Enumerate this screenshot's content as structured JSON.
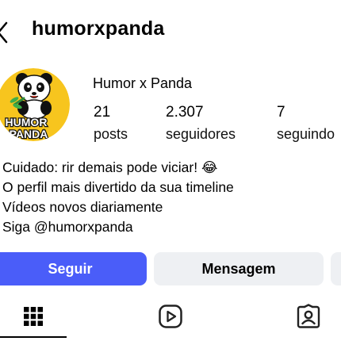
{
  "header": {
    "username": "humorxpanda"
  },
  "profile": {
    "display_name": "Humor x Panda",
    "avatar_text_top": "HUMOR",
    "avatar_text_bottom": "PANDA"
  },
  "stats": [
    {
      "value": "21",
      "label": "posts"
    },
    {
      "value": "2.307",
      "label": "seguidores"
    },
    {
      "value": "7",
      "label": "seguindo"
    }
  ],
  "bio": {
    "lines": [
      "Cuidado: rir demais pode viciar! 😂",
      "O perfil mais divertido da sua timeline",
      "Vídeos novos diariamente",
      "Siga @humorxpanda"
    ]
  },
  "actions": {
    "follow_label": "Seguir",
    "message_label": "Mensagem"
  },
  "tabs": [
    {
      "icon": "grid-icon",
      "active": true
    },
    {
      "icon": "reels-icon",
      "active": false
    },
    {
      "icon": "tagged-icon",
      "active": false
    }
  ],
  "colors": {
    "follow_button": "#4a5df9",
    "secondary_button": "#eef0f3",
    "avatar_background": "#f7c51e"
  }
}
